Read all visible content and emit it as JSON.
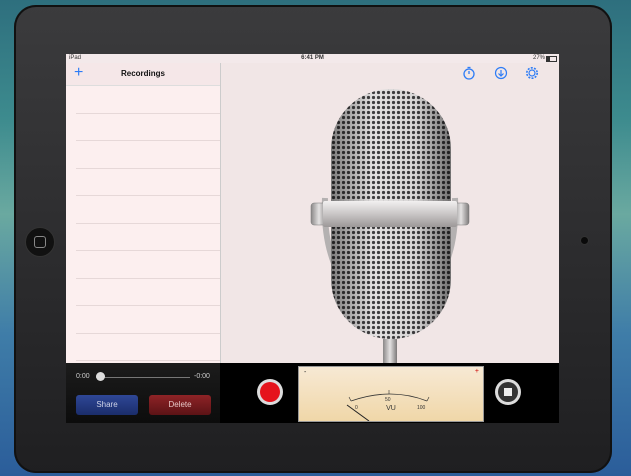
{
  "status_bar": {
    "device": "iPad",
    "time": "6:41 PM",
    "battery": "27%"
  },
  "left_panel": {
    "add_icon": "plus-icon",
    "title": "Recordings",
    "row_count": 10
  },
  "toolbar": {
    "icons": [
      "timer-icon",
      "download-icon",
      "settings-gear-icon"
    ],
    "accent": "#2d7cf6"
  },
  "player": {
    "elapsed": "0:00",
    "remaining": "-0:00",
    "progress": 0,
    "share_label": "Share",
    "delete_label": "Delete"
  },
  "vu_meter": {
    "minus": "-",
    "plus": "+",
    "ticks": [
      "0",
      "50",
      "100"
    ],
    "label": "VU"
  },
  "colors": {
    "record": "#e5131b",
    "share": "#2f4796",
    "delete": "#8e2326"
  }
}
